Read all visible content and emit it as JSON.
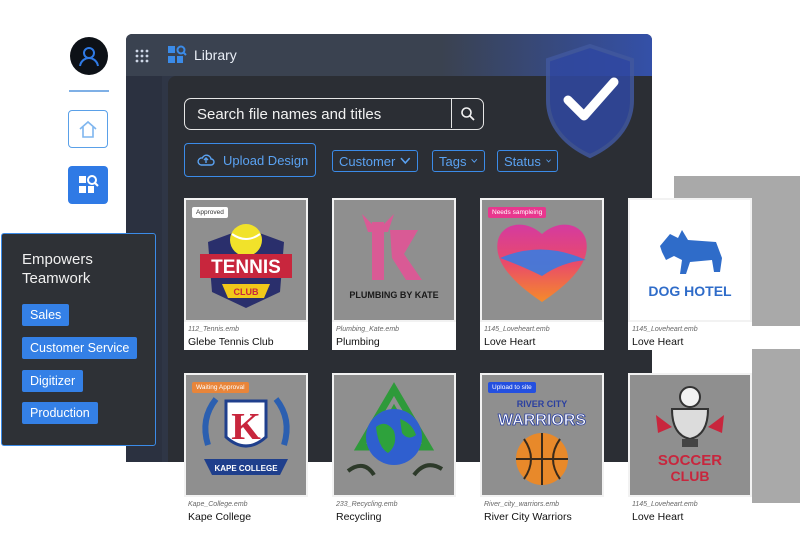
{
  "app": {
    "title": "Library"
  },
  "search": {
    "placeholder": "Search file names and titles"
  },
  "actions": {
    "upload_label": "Upload Design"
  },
  "filters": [
    {
      "label": "Customer"
    },
    {
      "label": "Tags"
    },
    {
      "label": "Status"
    }
  ],
  "cards": [
    {
      "file": "112_Tennis.emb",
      "title": "Glebe Tennis Club",
      "badge": "Approved"
    },
    {
      "file": "Plumbing_Kate.emb",
      "title": "Plumbing",
      "badge": ""
    },
    {
      "file": "1145_Loveheart.emb",
      "title": "Love Heart",
      "badge": "Needs sampleing"
    },
    {
      "file": "1145_Loveheart.emb",
      "title": "Love Heart",
      "badge": ""
    },
    {
      "file": "Kape_College.emb",
      "title": "Kape College",
      "badge": "Waiting Approval"
    },
    {
      "file": "233_Recycling.emb",
      "title": "Recycling",
      "badge": ""
    },
    {
      "file": "River_city_warriors.emb",
      "title": "River City Warriors",
      "badge": "Upload to site"
    },
    {
      "file": "1145_Loveheart.emb",
      "title": "Love Heart",
      "badge": ""
    }
  ],
  "artwork_text": {
    "tennis": "TENNIS",
    "tennis_sub": "CLUB",
    "plumbing": "PLUMBING BY KATE",
    "dog": "DOG HOTEL",
    "kape_letter": "K",
    "kape": "KAPE COLLEGE",
    "river_top": "RIVER CITY",
    "river": "WARRIORS",
    "soccer": "SOCCER",
    "soccer_sub": "CLUB"
  },
  "teamwork": {
    "title": "Empowers Teamwork",
    "roles": [
      "Sales",
      "Customer Service",
      "Digitizer",
      "Production"
    ]
  },
  "colors": {
    "accent": "#3b8be8",
    "chip": "#3480e6",
    "badge_approved": "#ffffff",
    "badge_sampling": "#e8378e",
    "badge_waiting": "#e8853a",
    "badge_upload": "#2450e0"
  },
  "icons": [
    "user-icon",
    "home-icon",
    "library-search-icon",
    "apps-grid-icon",
    "search-icon",
    "cloud-upload-icon",
    "chevron-down-icon",
    "shield-check-icon"
  ]
}
